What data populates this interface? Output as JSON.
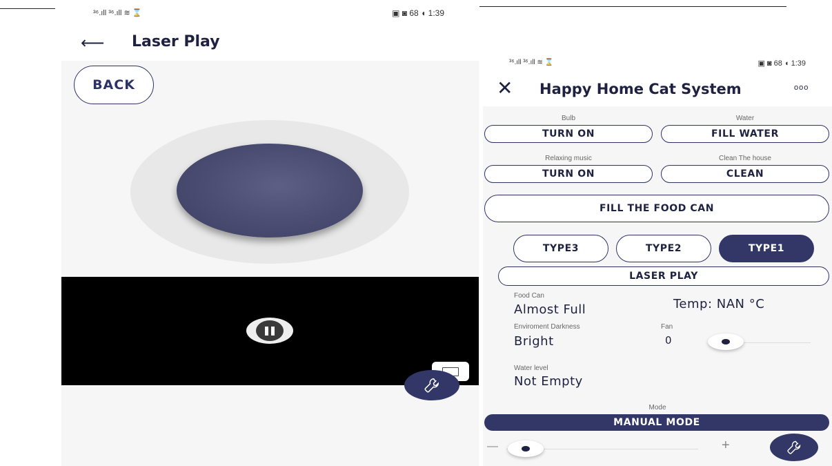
{
  "left_screen": {
    "status_left": "³⁶.ıll ³⁶.ıll ≋ ⌛",
    "status_right": "▣ ◙ 68 ◖ 1:39",
    "title": "Laser Play",
    "back_button": "BACK"
  },
  "right_screen": {
    "status_left": "³⁶.ıll ³⁶.ıll ≋ ⌛",
    "status_right": "▣ ◙ 68 ◖ 1:39",
    "title": "Happy Home Cat System",
    "menu_dots": "ooo",
    "controls": [
      {
        "label": "Bulb",
        "button": "TURN ON"
      },
      {
        "label": "Water",
        "button": "FILL WATER"
      },
      {
        "label": "Relaxing music",
        "button": "TURN ON"
      },
      {
        "label": "Clean The house",
        "button": "CLEAN"
      }
    ],
    "fill_food_button": "FILL THE FOOD CAN",
    "types": [
      "TYPE3",
      "TYPE2",
      "TYPE1"
    ],
    "selected_type": "TYPE1",
    "laser_play_button": "LASER PLAY",
    "food_can": {
      "label": "Food Can",
      "value": "Almost Full"
    },
    "temp": "Temp: NAN °C",
    "darkness": {
      "label": "Enviroment Darkness",
      "value": "Bright"
    },
    "fan": {
      "label": "Fan",
      "value": "0"
    },
    "water_level": {
      "label": "Water level",
      "value": "Not Empty"
    },
    "mode": {
      "label": "Mode",
      "value": "MANUAL MODE"
    },
    "bottom_slider": {
      "minus": "—",
      "plus": "+"
    }
  },
  "colors": {
    "primary": "#323767",
    "background": "#f6f6f6",
    "video": "#000000"
  },
  "icons": [
    "back-arrow-icon",
    "close-icon",
    "more-dots-icon",
    "pause-icon",
    "fullscreen-icon",
    "wrench-icon"
  ]
}
